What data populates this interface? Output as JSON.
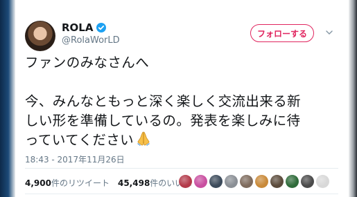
{
  "tweet": {
    "author": {
      "name": "ROLA",
      "handle": "@RolaWorLD",
      "verified": true
    },
    "follow_label": "フォローする",
    "text_lines": [
      "ファンのみなさんへ",
      "",
      "今、みんなともっと深く楽しく交流出来る新",
      "しい形を準備しているの。発表を楽しみに待",
      "っていてください"
    ],
    "emoji": "folded-hands-emoji",
    "timestamp": "18:43 - 2017年11月26日",
    "stats": {
      "retweet_count": "4,900",
      "retweet_label": "件のリツイート",
      "like_count": "45,498",
      "like_label": "件のいいね"
    },
    "liker_avatar_colors": [
      "#b33a4a",
      "#c94fa0",
      "#3b4a5a",
      "#8a8f95",
      "#7d6a5c",
      "#c98a3a",
      "#5a4a3a",
      "#2f6b3a",
      "#4a4a4a",
      "#d8d8d8"
    ]
  },
  "colors": {
    "accent_follow": "#e0245e",
    "verified": "#1da1f2",
    "text": "#14171a",
    "muted": "#657786"
  }
}
